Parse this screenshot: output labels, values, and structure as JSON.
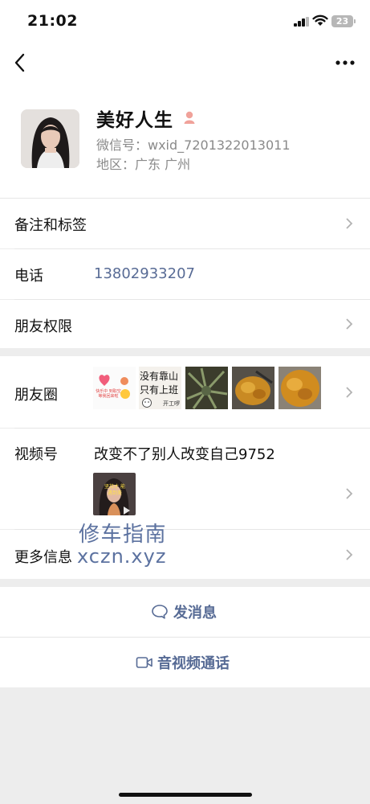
{
  "status_bar": {
    "time": "21:02",
    "battery": "23"
  },
  "nav": {
    "back_icon": "chevron-left-icon",
    "more_icon": "ellipsis-icon"
  },
  "profile": {
    "name": "美好人生",
    "wechat_id": "微信号：wxid_7201322013011",
    "region": "地区：广东 广州"
  },
  "rows": {
    "remark": "备注和标签",
    "phone_label": "电话",
    "phone_value": "13802933207",
    "permissions": "朋友权限",
    "moments": "朋友圈",
    "channels": "视频号",
    "channels_title": "改变不了别人改变自己9752",
    "more_info": "更多信息"
  },
  "moments_thumbs": {
    "t1_text": "快乐中 到取空 等我回来啦",
    "t2_line1": "没有靠山",
    "t2_line2": "只有上班",
    "t2_caption": "开工啰"
  },
  "channel_thumb_text": "坚持才 能遇到美",
  "watermark": {
    "line1": "修车指南",
    "line2": "xczn.xyz"
  },
  "actions": {
    "message": "发消息",
    "call": "音视频通话"
  },
  "colors": {
    "link": "#576b95",
    "background": "#ededed",
    "separator": "#e6e6e6"
  }
}
